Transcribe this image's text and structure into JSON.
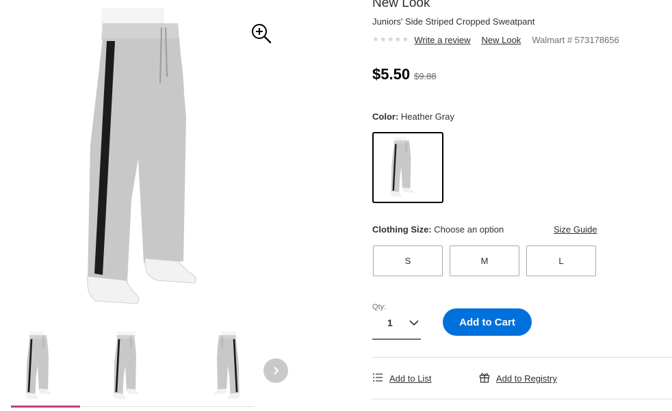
{
  "product": {
    "brand": "New Look",
    "title": "Juniors' Side Striped Cropped Sweatpant",
    "rating_stars": 5,
    "write_review": "Write a review",
    "brand_link": "New Look",
    "walmart_number": "Walmart # 573178656",
    "price": "$5.50",
    "was_price": "$9.88"
  },
  "color": {
    "label": "Color:",
    "value": "Heather Gray"
  },
  "size": {
    "label": "Clothing Size:",
    "value": "Choose an option",
    "guide": "Size Guide",
    "options": [
      "S",
      "M",
      "L"
    ]
  },
  "quantity": {
    "label": "Qty:",
    "value": "1"
  },
  "actions": {
    "add_to_cart": "Add to Cart",
    "add_to_list": "Add to List",
    "add_to_registry": "Add to Registry"
  },
  "gallery": {
    "thumbnail_count": 3,
    "selected_index": 0
  },
  "icons": {
    "zoom": "zoom-in-icon",
    "next": "chevron-right-icon",
    "qty": "chevron-down-icon",
    "list": "list-icon",
    "registry": "gift-icon",
    "star": "star-icon"
  },
  "colors": {
    "accent": "#0071dc",
    "thumb_selected": "#c13e85",
    "fabric": "#c8c8c8",
    "stripe": "#1c1c1c"
  }
}
